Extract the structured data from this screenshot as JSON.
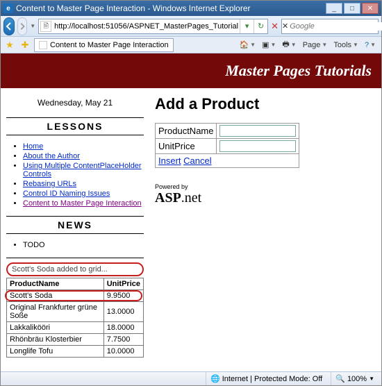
{
  "window": {
    "title": "Content to Master Page Interaction - Windows Internet Explorer"
  },
  "address": {
    "url": "http://localhost:51056/ASPNET_MasterPages_Tutorial"
  },
  "search": {
    "provider": "Google"
  },
  "tab": {
    "title": "Content to Master Page Interaction"
  },
  "toolbar": {
    "page": "Page",
    "tools": "Tools"
  },
  "banner": "Master Pages Tutorials",
  "sidebar": {
    "date": "Wednesday, May 21",
    "lessons_hdr": "LESSONS",
    "lessons": [
      "Home",
      "About the Author",
      "Using Multiple ContentPlaceHolder Controls",
      "Rebasing URLs",
      "Control ID Naming Issues",
      "Content to Master Page Interaction"
    ],
    "news_hdr": "NEWS",
    "news_item": "TODO",
    "status": "Scott's Soda added to grid...",
    "table": {
      "cols": [
        "ProductName",
        "UnitPrice"
      ],
      "rows": [
        [
          "Scott's Soda",
          "9.9500"
        ],
        [
          "Original Frankfurter grüne Soße",
          "13.0000"
        ],
        [
          "Lakkalikööri",
          "18.0000"
        ],
        [
          "Rhönbräu Klosterbier",
          "7.7500"
        ],
        [
          "Longlife Tofu",
          "10.0000"
        ]
      ]
    }
  },
  "main": {
    "heading": "Add a Product",
    "field1": "ProductName",
    "field2": "UnitPrice",
    "insert": "Insert",
    "cancel": "Cancel",
    "powered": "Powered by",
    "asp": "ASP",
    "net": ".net"
  },
  "status": {
    "zone": "Internet | Protected Mode: Off",
    "zoom": "100%"
  }
}
